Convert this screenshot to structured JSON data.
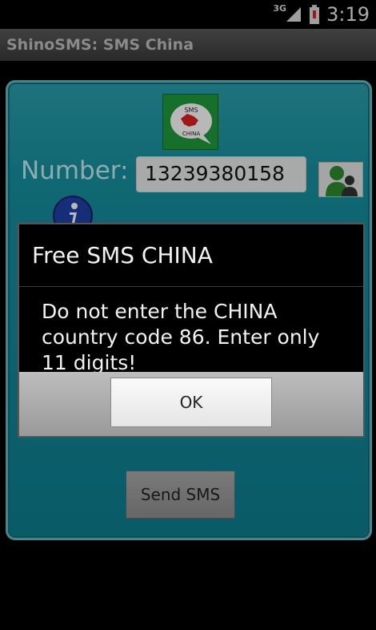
{
  "status_bar": {
    "network": "3G",
    "time": "3:19"
  },
  "app_bar": {
    "title": "ShinoSMS: SMS China"
  },
  "logo": {
    "line1": "SMS",
    "line2": "CHINA"
  },
  "form": {
    "number_label": "Number:",
    "number_value": "13239380158",
    "send_label": "Send SMS"
  },
  "dialog": {
    "title": "Free SMS CHINA",
    "message": "Do not enter the CHINA country code 86.  Enter only 11 digits!",
    "ok_label": "OK"
  },
  "colors": {
    "panel_teal": "#1690a0",
    "panel_border": "#69b8c0",
    "logo_green": "#1f9a3b",
    "battery_red": "#d22"
  },
  "icons": [
    "signal-icon",
    "battery-icon",
    "contact-icon",
    "info-icon",
    "app-logo-icon"
  ]
}
